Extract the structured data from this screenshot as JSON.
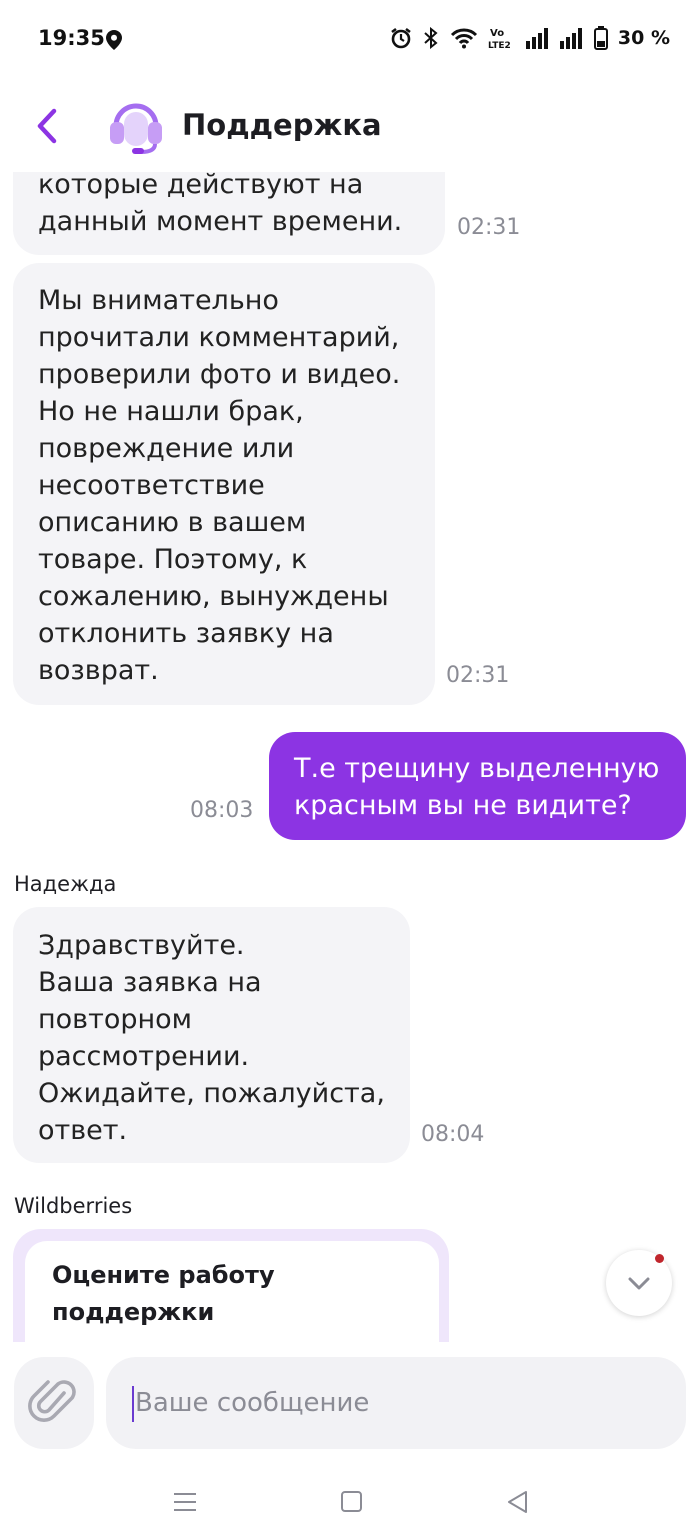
{
  "status_bar": {
    "time": "19:35",
    "battery": "30 %",
    "icons": [
      "location-icon",
      "alarm-icon",
      "bluetooth-icon",
      "wifi-icon",
      "volte-icon",
      "signal-icon",
      "signal-icon",
      "battery-icon"
    ]
  },
  "header": {
    "title": "Поддержка",
    "back_icon": "chevron-left-icon",
    "avatar_icon": "headset-icon",
    "accent_color": "#8c34e3"
  },
  "messages": [
    {
      "direction": "in",
      "text": "которые действуют на\nданный момент времени.",
      "time": "02:31"
    },
    {
      "direction": "in",
      "text": "Мы внимательно\nпрочитали комментарий,\nпроверили фото и видео.\nНо не нашли брак,\nповреждение или\nнесоответствие\nописанию в вашем\nтоваре. Поэтому, к\nсожалению, вынуждены\nотклонить заявку на\nвозврат.",
      "time": "02:31"
    },
    {
      "direction": "out",
      "text": "Т.е трещину выделенную\nкрасным вы не видите?",
      "time": "08:03"
    },
    {
      "direction": "in",
      "sender": "Надежда",
      "text": "Здравствуйте.\nВаша заявка на\nповторном\nрассмотрении.\nОжидайте, пожалуйста,\nответ.",
      "time": "08:04"
    }
  ],
  "rating_card": {
    "sender": "Wildberries",
    "title": "Оцените работу\nподдержки"
  },
  "input_bar": {
    "placeholder": "Ваше сообщение",
    "attach_icon": "paperclip-icon"
  },
  "nav_bar": [
    "menu-icon",
    "home-icon",
    "back-icon"
  ]
}
